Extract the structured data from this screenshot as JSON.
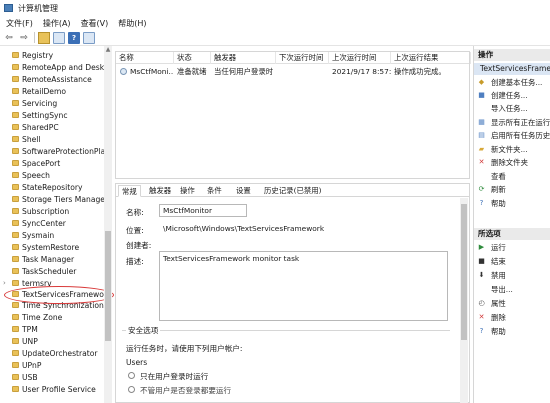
{
  "window": {
    "title": "计算机管理"
  },
  "menu": [
    "文件(F)",
    "操作(A)",
    "查看(V)",
    "帮助(H)"
  ],
  "tree": {
    "items": [
      {
        "label": "Registry"
      },
      {
        "label": "RemoteApp and Deskt"
      },
      {
        "label": "RemoteAssistance"
      },
      {
        "label": "RetailDemo"
      },
      {
        "label": "Servicing"
      },
      {
        "label": "SettingSync"
      },
      {
        "label": "SharedPC"
      },
      {
        "label": "Shell"
      },
      {
        "label": "SoftwareProtectionPlat"
      },
      {
        "label": "SpacePort"
      },
      {
        "label": "Speech"
      },
      {
        "label": "StateRepository"
      },
      {
        "label": "Storage Tiers Manager"
      },
      {
        "label": "Subscription"
      },
      {
        "label": "SyncCenter"
      },
      {
        "label": "Sysmain"
      },
      {
        "label": "SystemRestore"
      },
      {
        "label": "Task Manager"
      },
      {
        "label": "TaskScheduler"
      },
      {
        "label": "termsrv"
      },
      {
        "label": "TextServicesFramework"
      },
      {
        "label": "Time Synchronization"
      },
      {
        "label": "Time Zone"
      },
      {
        "label": "TPM"
      },
      {
        "label": "UNP"
      },
      {
        "label": "UpdateOrchestrator"
      },
      {
        "label": "UPnP"
      },
      {
        "label": "USB"
      },
      {
        "label": "User Profile Service"
      }
    ]
  },
  "task_list": {
    "columns": [
      "名称",
      "状态",
      "触发器",
      "下次运行时间",
      "上次运行时间",
      "上次运行结果"
    ],
    "rows": [
      {
        "name": "MsCtfMoni...",
        "status": "准备就绪",
        "trigger": "当任何用户登录时",
        "next_run": "",
        "last_run": "2021/9/17 8:57:49",
        "last_result": "操作成功完成。"
      }
    ]
  },
  "detail": {
    "tabs": [
      "常规",
      "触发器",
      "操作",
      "条件",
      "设置",
      "历史记录(已禁用)"
    ],
    "name_label": "名称:",
    "name_value": "MsCtfMonitor",
    "location_label": "位置:",
    "location_value": "\\Microsoft\\Windows\\TextServicesFramework",
    "author_label": "创建者:",
    "description_label": "描述:",
    "description_value": "TextServicesFramework monitor task",
    "security": {
      "title": "安全选项",
      "run_as_label": "运行任务时，请使用下列用户帐户:",
      "account": "Users",
      "option1": "只在用户登录时运行",
      "option2": "不管用户是否登录都要运行"
    }
  },
  "actions": {
    "header": "操作",
    "selected_folder": "TextServicesFramework",
    "folder_actions": [
      {
        "icon": "create-basic-task-icon",
        "label": "创建基本任务..."
      },
      {
        "icon": "create-task-icon",
        "label": "创建任务..."
      },
      {
        "icon": "import-icon",
        "label": "导入任务..."
      },
      {
        "icon": "display-running-icon",
        "label": "显示所有正在运行的任务"
      },
      {
        "icon": "history-icon",
        "label": "启用所有任务历史记录"
      },
      {
        "icon": "new-folder-icon",
        "label": "新文件夹..."
      },
      {
        "icon": "delete-folder-icon",
        "label": "删除文件夹"
      },
      {
        "icon": "view-icon",
        "label": "查看"
      },
      {
        "icon": "refresh-icon",
        "label": "刷新"
      },
      {
        "icon": "help-icon",
        "label": "帮助"
      }
    ],
    "selected_header": "所选项",
    "item_actions": [
      {
        "icon": "run-icon",
        "label": "运行"
      },
      {
        "icon": "end-icon",
        "label": "结束"
      },
      {
        "icon": "disable-icon",
        "label": "禁用"
      },
      {
        "icon": "export-icon",
        "label": "导出..."
      },
      {
        "icon": "properties-icon",
        "label": "属性"
      },
      {
        "icon": "delete-icon",
        "label": "删除"
      },
      {
        "icon": "help-icon",
        "label": "帮助"
      }
    ]
  }
}
